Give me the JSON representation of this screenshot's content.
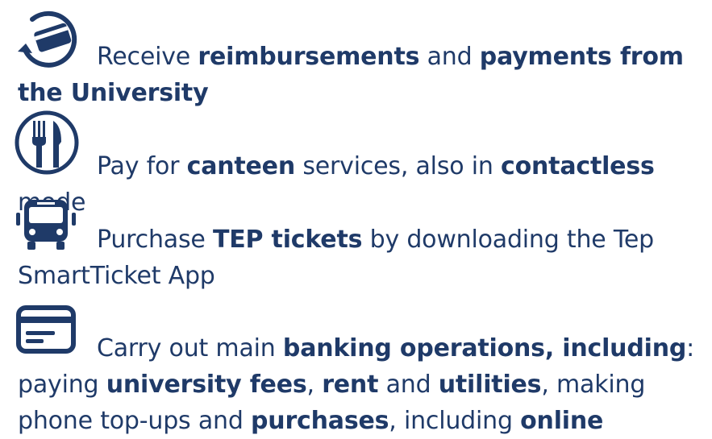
{
  "colors": {
    "text": "#1f3a68",
    "icon": "#1f3a68"
  },
  "features": [
    {
      "icon": "card-payment-icon",
      "segments": [
        {
          "text": "Receive ",
          "bold": false
        },
        {
          "text": "reimbursements",
          "bold": true
        },
        {
          "text": " and ",
          "bold": false
        },
        {
          "text": "payments from the University",
          "bold": true
        }
      ]
    },
    {
      "icon": "fork-knife-icon",
      "segments": [
        {
          "text": "Pay for ",
          "bold": false
        },
        {
          "text": "canteen",
          "bold": true
        },
        {
          "text": " services, also in ",
          "bold": false
        },
        {
          "text": "contactless",
          "bold": true
        },
        {
          "text": " mode",
          "bold": false
        }
      ]
    },
    {
      "icon": "bus-icon",
      "segments": [
        {
          "text": "Purchase ",
          "bold": false
        },
        {
          "text": "TEP tickets",
          "bold": true
        },
        {
          "text": " by downloading the Tep SmartTicket App",
          "bold": false
        }
      ]
    },
    {
      "icon": "credit-card-icon",
      "segments": [
        {
          "text": "Carry out main ",
          "bold": false
        },
        {
          "text": "banking operations, including",
          "bold": true
        },
        {
          "text": ": paying ",
          "bold": false
        },
        {
          "text": "university fees",
          "bold": true
        },
        {
          "text": ", ",
          "bold": false
        },
        {
          "text": "rent",
          "bold": true
        },
        {
          "text": " and ",
          "bold": false
        },
        {
          "text": "utilities",
          "bold": true
        },
        {
          "text": ", making phone top-ups and ",
          "bold": false
        },
        {
          "text": "purchases",
          "bold": true
        },
        {
          "text": ", including ",
          "bold": false
        },
        {
          "text": "online",
          "bold": true
        }
      ]
    }
  ]
}
